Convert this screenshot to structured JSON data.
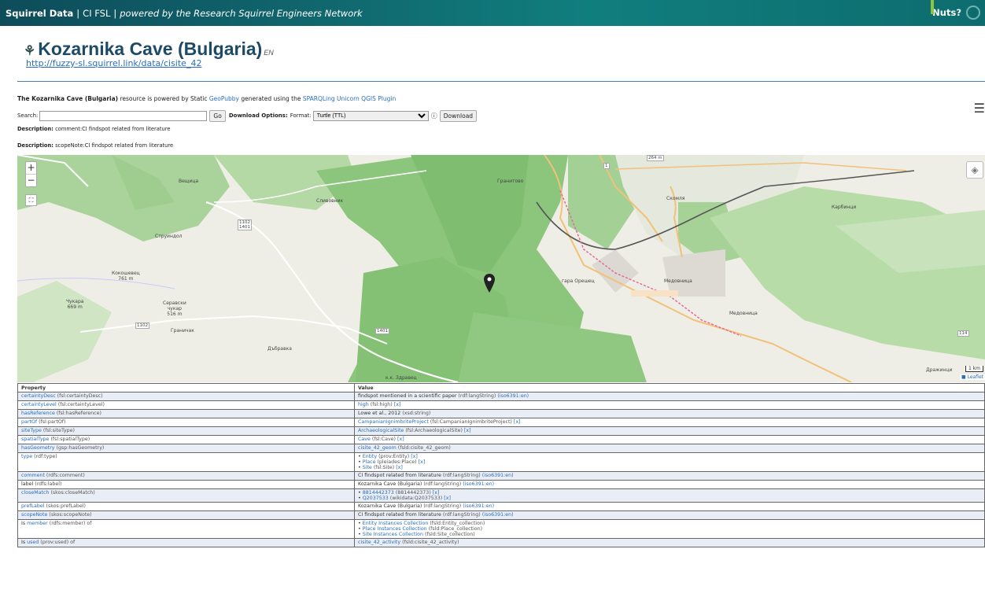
{
  "topbar": {
    "brand": "Squirrel Data",
    "project": "CI FSL",
    "tagline": "powered by the Research Squirrel Engineers Network",
    "nuts": "Nuts?"
  },
  "header": {
    "title": "Kozarnika Cave (Bulgaria)",
    "lang": "EN",
    "uri": "http://fuzzy-sl.squirrel.link/data/cisite_42"
  },
  "intro": {
    "name": "The Kozarnika Cave (Bulgaria)",
    "t1": " resource is powered by Static ",
    "geopubby": "GeoPubby",
    "t2": " generated using the ",
    "plugin": "SPARQLing Unicorn QGIS Plugin"
  },
  "search": {
    "label": "Search:",
    "value": "",
    "go": "Go",
    "download_options": "Download Options:",
    "format_label": "Format:",
    "format_value": "Turtle (TTL)",
    "download": "Download"
  },
  "descriptions": [
    {
      "label": "Description:",
      "text": " comment:CI findspot related from literature"
    },
    {
      "label": "Description:",
      "text": " scopeNote:CI findspot related from literature"
    }
  ],
  "map": {
    "zoom_in": "+",
    "zoom_out": "−",
    "scale": "1 km",
    "attribution": "Leaflet",
    "places": [
      {
        "name": "Сливовник"
      },
      {
        "name": "Струиндол"
      },
      {
        "name": "Вещица"
      },
      {
        "name": "Кокошевец\n761 m"
      },
      {
        "name": "Чукара\n669 m"
      },
      {
        "name": "Сеpaвски\nчукар\n516 m"
      },
      {
        "name": "Граничак"
      },
      {
        "name": "Дъбравка"
      },
      {
        "name": "Гранитово"
      },
      {
        "name": "гара Орешец"
      },
      {
        "name": "Медовница"
      },
      {
        "name": "Скомля"
      },
      {
        "name": "Карбинци"
      },
      {
        "name": "к.к. Здравец"
      },
      {
        "name": "Дражинци"
      },
      {
        "name": "Медовница"
      }
    ],
    "roads": [
      "1102\n1401",
      "1102",
      "1401",
      "114",
      "1",
      "264 m"
    ]
  },
  "table": {
    "headers": [
      "Property",
      "Value"
    ],
    "rows": [
      {
        "p": "certaintyDesc",
        "pq": " (fsl:certaintyDesc)",
        "v": "findspot mentioned in a scientific paper",
        "vq": " (rdf:langString) ",
        "vl": "(iso6391:en)",
        "plain": true
      },
      {
        "p": "certaintyLevel",
        "pq": " (fsl:certaintyLevel)",
        "v": "high",
        "vq": " (fsl:high) ",
        "vl": "[x]"
      },
      {
        "p": "hasReference",
        "pq": " (fsl:hasReference)",
        "v": "Lowe et al., 2012",
        "vq": " (xsd:string)",
        "vl": "",
        "plain": true
      },
      {
        "p": "partOf",
        "pq": " (fsl:partOf)",
        "v": "CampanianIgnimbriteProject",
        "vq": " (fsl:CampanianIgnimbriteProject) ",
        "vl": "[x]"
      },
      {
        "p": "siteType",
        "pq": " (fsl:siteType)",
        "v": "ArchaeologicalSite",
        "vq": " (fsl:ArchaeologicalSite) ",
        "vl": "[x]"
      },
      {
        "p": "spatialType",
        "pq": " (fsl:spatialType)",
        "v": "Cave",
        "vq": " (fsl:Cave) ",
        "vl": "[x]"
      },
      {
        "p": "hasGeometry",
        "pq": " (gsp:hasGeometry)",
        "v": "cisite_42_geom",
        "vq": " (fsld:cisite_42_geom)",
        "vl": ""
      }
    ],
    "type_row": {
      "p": "type",
      "pq": " (rdf:type)",
      "items": [
        {
          "v": "Entity",
          "q": " (prov:Entity) ",
          "x": "[x]"
        },
        {
          "v": "Place",
          "q": " (pleiades:Place) ",
          "x": "[x]"
        },
        {
          "v": "Site",
          "q": " (fsl:Site) ",
          "x": "[x]"
        }
      ]
    },
    "rows2": [
      {
        "p": "comment",
        "pq": " (rdfs:comment)",
        "v": "CI findspot related from literature",
        "vq": " (rdf:langString) ",
        "vl": "(iso6391:en)",
        "plain": true
      },
      {
        "p": "label",
        "pq": " (rdfs:label)",
        "v": "Kozarnika Cave (Bulgaria)",
        "vq": " (rdf:langString) ",
        "vl": "(iso6391:en)",
        "plain": true,
        "plainp": true
      }
    ],
    "close_row": {
      "p": "closeMatch",
      "pq": " (skos:closeMatch)",
      "items": [
        {
          "v": "8814442373",
          "q": " (8814442373) ",
          "x": "[x]"
        },
        {
          "v": "Q2037533",
          "q": " (wikidata:Q2037533) ",
          "x": "[x]"
        }
      ]
    },
    "rows3": [
      {
        "p": "prefLabel",
        "pq": " (skos:prefLabel)",
        "v": "Kozarnika Cave (Bulgaria)",
        "vq": " (rdf:langString) ",
        "vl": "(iso6391:en)",
        "plain": true
      },
      {
        "p": "scopeNote",
        "pq": " (skos:scopeNote)",
        "v": "CI findspot related from literature",
        "vq": " (rdf:langString) ",
        "vl": "(iso6391:en)",
        "plain": true
      }
    ],
    "member_row": {
      "pre": "Is ",
      "p": "member",
      "pq": " (rdfs:member) of",
      "items": [
        {
          "v": "Entity Instances Collection",
          "q": " (fsld:Entity_collection)"
        },
        {
          "v": "Place Instances Collection",
          "q": " (fsld:Place_collection)"
        },
        {
          "v": "Site Instances Collection",
          "q": " (fsld:Site_collection)"
        }
      ]
    },
    "used_row": {
      "pre": "Is ",
      "p": "used",
      "pq": " (prov:used) of",
      "v": "cisite_42_activity",
      "vq": " (fsld:cisite_42_activity)"
    }
  }
}
